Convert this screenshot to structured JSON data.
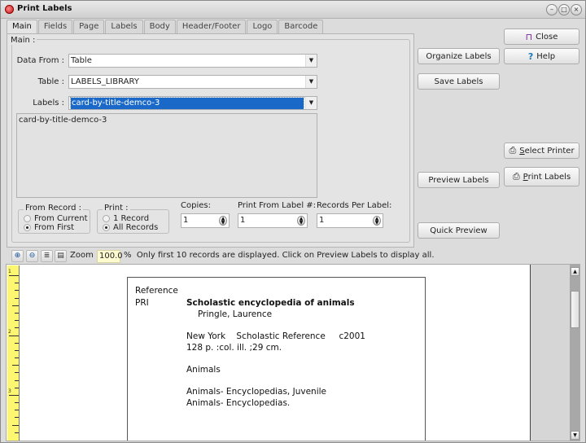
{
  "window": {
    "title": "Print Labels",
    "controls": [
      "minimize",
      "maximize",
      "close"
    ]
  },
  "tabs": [
    {
      "label": "Main",
      "active": true
    },
    {
      "label": "Fields",
      "active": false
    },
    {
      "label": "Page",
      "active": false
    },
    {
      "label": "Labels",
      "active": false
    },
    {
      "label": "Body",
      "active": false
    },
    {
      "label": "Header/Footer",
      "active": false
    },
    {
      "label": "Logo",
      "active": false
    },
    {
      "label": "Barcode",
      "active": false
    }
  ],
  "main": {
    "group_label": "Main :",
    "data_from": {
      "label": "Data From :",
      "value": "Table"
    },
    "table": {
      "label": "Table :",
      "value": "LABELS_LIBRARY"
    },
    "labels": {
      "label": "Labels :",
      "value": "card-by-title-demco-3"
    },
    "description": "card-by-title-demco-3",
    "from_record": {
      "label": "From Record :",
      "options": [
        {
          "label": "From Current",
          "selected": false
        },
        {
          "label": "From First",
          "selected": true
        }
      ]
    },
    "print": {
      "label": "Print :",
      "options": [
        {
          "label": "1 Record",
          "selected": false
        },
        {
          "label": "All Records",
          "selected": true
        }
      ]
    },
    "copies": {
      "label": "Copies:",
      "value": "1"
    },
    "print_from_label": {
      "label": "Print From Label #:",
      "value": "1"
    },
    "records_per_label": {
      "label": "Records Per Label:",
      "value": "1"
    }
  },
  "buttons": {
    "close": "Close",
    "help": "Help",
    "organize_labels": "Organize Labels",
    "save_labels": "Save Labels",
    "select_printer_u": "S",
    "select_printer_rest": "elect Printer",
    "print_labels_u": "P",
    "print_labels_rest": "rint Labels",
    "preview_labels": "Preview Labels",
    "quick_preview": "Quick Preview"
  },
  "icons": {
    "close": "exit-door-icon",
    "help": "question-mark-icon",
    "printer": "printer-icon",
    "zoom_in": "zoom-in-icon",
    "zoom_out": "zoom-out-icon"
  },
  "zoombar": {
    "label": "Zoom",
    "value": "100.0",
    "unit": "%",
    "message": "Only first 10 records are displayed. Click on Preview Labels to display all."
  },
  "ruler": {
    "marks": [
      "1",
      "2",
      "3"
    ]
  },
  "label_preview": {
    "line1": "Reference",
    "call_no": "PRI",
    "title": "Scholastic encyclopedia of animals",
    "author": "Pringle, Laurence",
    "publication": "New York    Scholastic Reference     c2001",
    "physical": "128 p. :col. ill. ;29 cm.",
    "subject": "Animals",
    "subject2": "Animals- Encyclopedias, Juvenile",
    "subject3": "Animals- Encyclopedias."
  }
}
